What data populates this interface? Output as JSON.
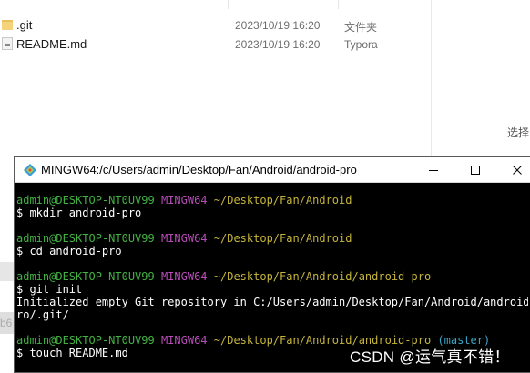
{
  "explorer": {
    "files": [
      {
        "name": ".git",
        "date": "2023/10/19 16:20",
        "type": "文件夹",
        "icon": "folder-icon"
      },
      {
        "name": "README.md",
        "date": "2023/10/19 16:20",
        "type": "Typora",
        "icon": "markdown-file-icon"
      }
    ],
    "right_label": "选择",
    "left_fragment": "b6"
  },
  "terminal": {
    "title": "MINGW64:/c/Users/admin/Desktop/Fan/Android/android-pro",
    "lines": [
      {
        "kind": "prompt",
        "user": "admin@DESKTOP-NT0UV99",
        "system": "MINGW64",
        "path": "~/Desktop/Fan/Android",
        "branch": ""
      },
      {
        "kind": "cmd",
        "text": "$ mkdir android-pro"
      },
      {
        "kind": "blank"
      },
      {
        "kind": "prompt",
        "user": "admin@DESKTOP-NT0UV99",
        "system": "MINGW64",
        "path": "~/Desktop/Fan/Android",
        "branch": ""
      },
      {
        "kind": "cmd",
        "text": "$ cd android-pro"
      },
      {
        "kind": "blank"
      },
      {
        "kind": "prompt",
        "user": "admin@DESKTOP-NT0UV99",
        "system": "MINGW64",
        "path": "~/Desktop/Fan/Android/android-pro",
        "branch": ""
      },
      {
        "kind": "cmd",
        "text": "$ git init"
      },
      {
        "kind": "output",
        "text": "Initialized empty Git repository in C:/Users/admin/Desktop/Fan/Android/android-p"
      },
      {
        "kind": "output",
        "text": "ro/.git/"
      },
      {
        "kind": "blank"
      },
      {
        "kind": "prompt",
        "user": "admin@DESKTOP-NT0UV99",
        "system": "MINGW64",
        "path": "~/Desktop/Fan/Android/android-pro",
        "branch": "(master)"
      },
      {
        "kind": "cmd",
        "text": "$ touch README.md"
      }
    ]
  },
  "watermark": "CSDN @运气真不错！"
}
